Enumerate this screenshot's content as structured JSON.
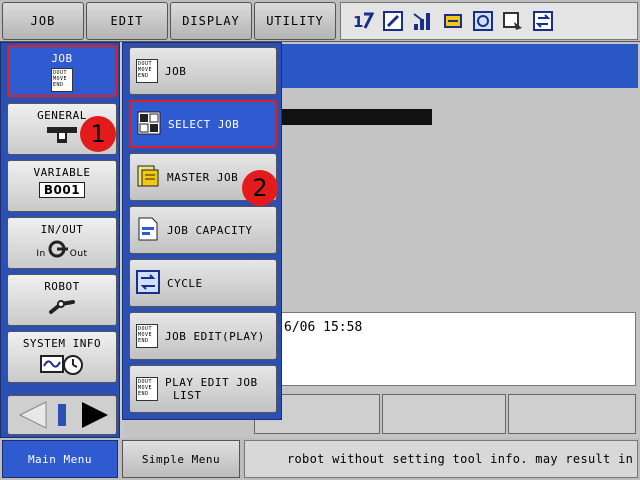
{
  "top_menu": {
    "job": "JOB",
    "edit": "EDIT",
    "display": "DISPLAY",
    "utility": "UTILITY"
  },
  "status_icons": [
    "coordinate-icon",
    "edit-mode-icon",
    "signal-icon",
    "servo-icon",
    "teach-icon",
    "play-icon",
    "cycle-icon"
  ],
  "main_menu": {
    "items": [
      {
        "label": "JOB",
        "icon": "job-doc-icon",
        "active": true
      },
      {
        "label": "GENERAL",
        "icon": "tool-icon"
      },
      {
        "label": "VARIABLE",
        "icon": "variable-icon",
        "badge": "B001"
      },
      {
        "label": "IN/OUT",
        "icon": "io-icon",
        "in": "In",
        "out": "Out"
      },
      {
        "label": "ROBOT",
        "icon": "robot-arm-icon"
      },
      {
        "label": "SYSTEM INFO",
        "icon": "system-info-icon"
      }
    ]
  },
  "doc_icon_text": "DOUT MOVE END",
  "submenu": {
    "items": [
      {
        "label": "JOB"
      },
      {
        "label": "SELECT JOB",
        "active": true
      },
      {
        "label": "MASTER JOB"
      },
      {
        "label": "JOB CAPACITY"
      },
      {
        "label": "CYCLE"
      },
      {
        "label": "JOB EDIT(PLAY)"
      },
      {
        "label": "PLAY EDIT JOB",
        "label2": "LIST"
      }
    ]
  },
  "markers": [
    "1",
    "2"
  ],
  "work_area": {
    "timestamp": "6/06 15:58"
  },
  "bottom_bar": {
    "main_menu": "Main Menu",
    "simple_menu": "Simple Menu",
    "message": "robot without setting tool info. may result in pro"
  },
  "colors": {
    "accent_blue": "#2f5ad0",
    "highlight_red": "#e02020",
    "panel_blue": "#2b4fb2"
  }
}
